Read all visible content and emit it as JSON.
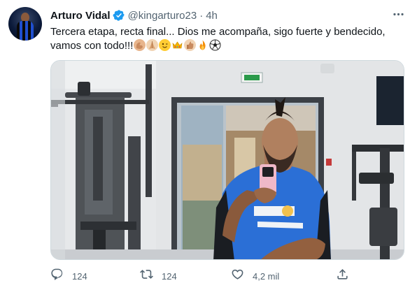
{
  "tweet": {
    "author_name": "Arturo Vidal",
    "handle": "@kingarturo23",
    "separator": "·",
    "time": "4h",
    "text_line1": "Tercera etapa, recta final... Dios me acompaña, sigo fuerte y bendecido,",
    "text_line2": "vamos con todo!!!",
    "emojis": [
      "flexed-biceps",
      "folded-hands",
      "winking-face",
      "crown",
      "thumbs-up",
      "fire",
      "soccer-ball"
    ],
    "media": {
      "description_icon": "gym-selfie-photo"
    },
    "actions": {
      "reply_count": "124",
      "retweet_count": "124",
      "like_count": "4,2 mil"
    }
  },
  "colors": {
    "text": "#0f1419",
    "secondary": "#536471",
    "verified": "#1d9bf0",
    "border": "#cfd9de"
  }
}
